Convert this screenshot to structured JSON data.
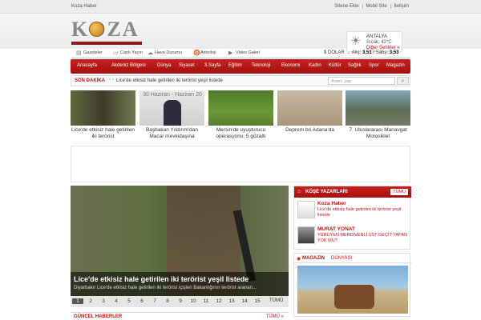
{
  "topbar": {
    "site_name": "Koza Haber",
    "links": [
      "Sitene Ekle",
      "Mobil Site",
      "İletişim"
    ]
  },
  "logo": {
    "text": "KOZA"
  },
  "weather": {
    "icon": "sun-icon",
    "city": "ANTALYA",
    "temp": "Sıcak, 42°C",
    "other": "Diğer Şehirler »"
  },
  "subnav": {
    "items": [
      {
        "label": "Gazeteler",
        "icon": "newspaper-icon"
      },
      {
        "label": "Canlı Yayın",
        "icon": "tv-icon"
      },
      {
        "label": "Hava Durumu",
        "icon": "cloud-icon"
      },
      {
        "label": "Astroloji",
        "icon": "astro-icon"
      },
      {
        "label": "Video Galeri",
        "icon": "video-icon"
      }
    ]
  },
  "currency": {
    "label": "$ DOLAR → Alış:",
    "buy": "3,51",
    "sep": "/ Satış:",
    "sell": "3,53"
  },
  "mainnav": {
    "items": [
      "Anasayfa",
      "Akdeniz Bölgesi",
      "Dünya",
      "Siyaset",
      "3.Sayfa",
      "Eğitim",
      "Teknoloji",
      "Ekonomi",
      "Kadın",
      "Kültür",
      "Sağlık",
      "Spor",
      "Magazin"
    ]
  },
  "breaking": {
    "label": "SON DAKİKA",
    "arrows": "‹ ›",
    "text": "Lice'de etkisiz hale getirilen iki terörist yeşil listede",
    "search_placeholder": "Aramı yap"
  },
  "thumbs": [
    {
      "caption": "Lice'de etkisiz hale getirilen iki terörist"
    },
    {
      "caption": "Başbakan Yıldırım'dan Macar mevkidaşına"
    },
    {
      "caption": "Mersin'de uyuşturucu operasyonu: 5 gözaltı"
    },
    {
      "caption": "Deprem bri Adana'da"
    },
    {
      "caption": "7. Uluslararası Manavgat Motosiklet"
    }
  ],
  "thumb2_overlay": "30 Haziran - Haziran 20",
  "slider": {
    "title": "Lice'de etkisiz hale getirilen iki terörist yeşil listede",
    "subtitle": "Diyarbakır Lice'de etkisiz hale getirilen iki terörist içişleri Bakanlığının terörist aranan...",
    "pages": [
      "1",
      "2",
      "3",
      "4",
      "5",
      "6",
      "7",
      "8",
      "9",
      "10",
      "11",
      "12",
      "13",
      "14",
      "15"
    ],
    "all_label": "TÜMÜ"
  },
  "guncel": {
    "label": "GÜNCEL HABERLER",
    "all_label": "TÜMÜ »"
  },
  "kose": {
    "title": "KÖŞE YAZARLARI",
    "all_label": "TÜMÜ",
    "authors": [
      {
        "name": "Koza Haber",
        "title": "Lice'de etkisiz hale getirilen iki terörist yeşil listede"
      },
      {
        "name": "MURAT YONAT",
        "title": "YÜRÜYEN MERDİVENLİ ÜST GEÇİT YAPAN YOK MU?"
      }
    ]
  },
  "magazin": {
    "title": "MAGAZİN",
    "title2": "DÜNYASI"
  }
}
